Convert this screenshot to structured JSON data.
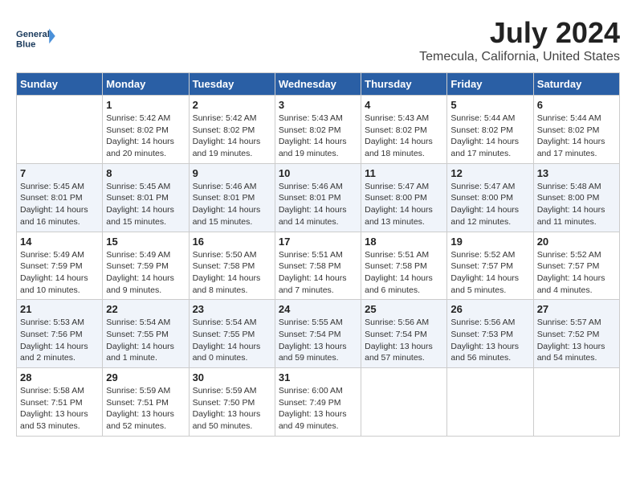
{
  "header": {
    "logo_line1": "General",
    "logo_line2": "Blue",
    "month_title": "July 2024",
    "location": "Temecula, California, United States"
  },
  "days_of_week": [
    "Sunday",
    "Monday",
    "Tuesday",
    "Wednesday",
    "Thursday",
    "Friday",
    "Saturday"
  ],
  "weeks": [
    [
      {
        "date": "",
        "content": ""
      },
      {
        "date": "1",
        "content": "Sunrise: 5:42 AM\nSunset: 8:02 PM\nDaylight: 14 hours\nand 20 minutes."
      },
      {
        "date": "2",
        "content": "Sunrise: 5:42 AM\nSunset: 8:02 PM\nDaylight: 14 hours\nand 19 minutes."
      },
      {
        "date": "3",
        "content": "Sunrise: 5:43 AM\nSunset: 8:02 PM\nDaylight: 14 hours\nand 19 minutes."
      },
      {
        "date": "4",
        "content": "Sunrise: 5:43 AM\nSunset: 8:02 PM\nDaylight: 14 hours\nand 18 minutes."
      },
      {
        "date": "5",
        "content": "Sunrise: 5:44 AM\nSunset: 8:02 PM\nDaylight: 14 hours\nand 17 minutes."
      },
      {
        "date": "6",
        "content": "Sunrise: 5:44 AM\nSunset: 8:02 PM\nDaylight: 14 hours\nand 17 minutes."
      }
    ],
    [
      {
        "date": "7",
        "content": "Sunrise: 5:45 AM\nSunset: 8:01 PM\nDaylight: 14 hours\nand 16 minutes."
      },
      {
        "date": "8",
        "content": "Sunrise: 5:45 AM\nSunset: 8:01 PM\nDaylight: 14 hours\nand 15 minutes."
      },
      {
        "date": "9",
        "content": "Sunrise: 5:46 AM\nSunset: 8:01 PM\nDaylight: 14 hours\nand 15 minutes."
      },
      {
        "date": "10",
        "content": "Sunrise: 5:46 AM\nSunset: 8:01 PM\nDaylight: 14 hours\nand 14 minutes."
      },
      {
        "date": "11",
        "content": "Sunrise: 5:47 AM\nSunset: 8:00 PM\nDaylight: 14 hours\nand 13 minutes."
      },
      {
        "date": "12",
        "content": "Sunrise: 5:47 AM\nSunset: 8:00 PM\nDaylight: 14 hours\nand 12 minutes."
      },
      {
        "date": "13",
        "content": "Sunrise: 5:48 AM\nSunset: 8:00 PM\nDaylight: 14 hours\nand 11 minutes."
      }
    ],
    [
      {
        "date": "14",
        "content": "Sunrise: 5:49 AM\nSunset: 7:59 PM\nDaylight: 14 hours\nand 10 minutes."
      },
      {
        "date": "15",
        "content": "Sunrise: 5:49 AM\nSunset: 7:59 PM\nDaylight: 14 hours\nand 9 minutes."
      },
      {
        "date": "16",
        "content": "Sunrise: 5:50 AM\nSunset: 7:58 PM\nDaylight: 14 hours\nand 8 minutes."
      },
      {
        "date": "17",
        "content": "Sunrise: 5:51 AM\nSunset: 7:58 PM\nDaylight: 14 hours\nand 7 minutes."
      },
      {
        "date": "18",
        "content": "Sunrise: 5:51 AM\nSunset: 7:58 PM\nDaylight: 14 hours\nand 6 minutes."
      },
      {
        "date": "19",
        "content": "Sunrise: 5:52 AM\nSunset: 7:57 PM\nDaylight: 14 hours\nand 5 minutes."
      },
      {
        "date": "20",
        "content": "Sunrise: 5:52 AM\nSunset: 7:57 PM\nDaylight: 14 hours\nand 4 minutes."
      }
    ],
    [
      {
        "date": "21",
        "content": "Sunrise: 5:53 AM\nSunset: 7:56 PM\nDaylight: 14 hours\nand 2 minutes."
      },
      {
        "date": "22",
        "content": "Sunrise: 5:54 AM\nSunset: 7:55 PM\nDaylight: 14 hours\nand 1 minute."
      },
      {
        "date": "23",
        "content": "Sunrise: 5:54 AM\nSunset: 7:55 PM\nDaylight: 14 hours\nand 0 minutes."
      },
      {
        "date": "24",
        "content": "Sunrise: 5:55 AM\nSunset: 7:54 PM\nDaylight: 13 hours\nand 59 minutes."
      },
      {
        "date": "25",
        "content": "Sunrise: 5:56 AM\nSunset: 7:54 PM\nDaylight: 13 hours\nand 57 minutes."
      },
      {
        "date": "26",
        "content": "Sunrise: 5:56 AM\nSunset: 7:53 PM\nDaylight: 13 hours\nand 56 minutes."
      },
      {
        "date": "27",
        "content": "Sunrise: 5:57 AM\nSunset: 7:52 PM\nDaylight: 13 hours\nand 54 minutes."
      }
    ],
    [
      {
        "date": "28",
        "content": "Sunrise: 5:58 AM\nSunset: 7:51 PM\nDaylight: 13 hours\nand 53 minutes."
      },
      {
        "date": "29",
        "content": "Sunrise: 5:59 AM\nSunset: 7:51 PM\nDaylight: 13 hours\nand 52 minutes."
      },
      {
        "date": "30",
        "content": "Sunrise: 5:59 AM\nSunset: 7:50 PM\nDaylight: 13 hours\nand 50 minutes."
      },
      {
        "date": "31",
        "content": "Sunrise: 6:00 AM\nSunset: 7:49 PM\nDaylight: 13 hours\nand 49 minutes."
      },
      {
        "date": "",
        "content": ""
      },
      {
        "date": "",
        "content": ""
      },
      {
        "date": "",
        "content": ""
      }
    ]
  ]
}
